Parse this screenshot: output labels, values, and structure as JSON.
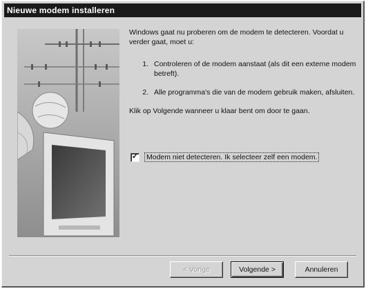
{
  "dialog": {
    "title": "Nieuwe modem installeren"
  },
  "content": {
    "intro": "Windows gaat nu proberen om de modem te detecteren. Voordat u verder gaat, moet u:",
    "steps": [
      {
        "num": "1.",
        "text": "Controleren of de modem aanstaat (als dit een externe modem betreft)."
      },
      {
        "num": "2.",
        "text": "Alle programma's die van de modem gebruik maken, afsluiten."
      }
    ],
    "instruction": "Klik op Volgende wanneer u klaar bent om door te gaan."
  },
  "checkbox": {
    "label": "Modem niet detecteren. Ik selecteer zelf een modem.",
    "checked": true,
    "mark": "✓"
  },
  "buttons": {
    "back": "< Vorige",
    "next": "Volgende >",
    "cancel": "Annuleren"
  },
  "icons": {
    "illustration": "monitor-and-telephone-pole-illustration"
  }
}
